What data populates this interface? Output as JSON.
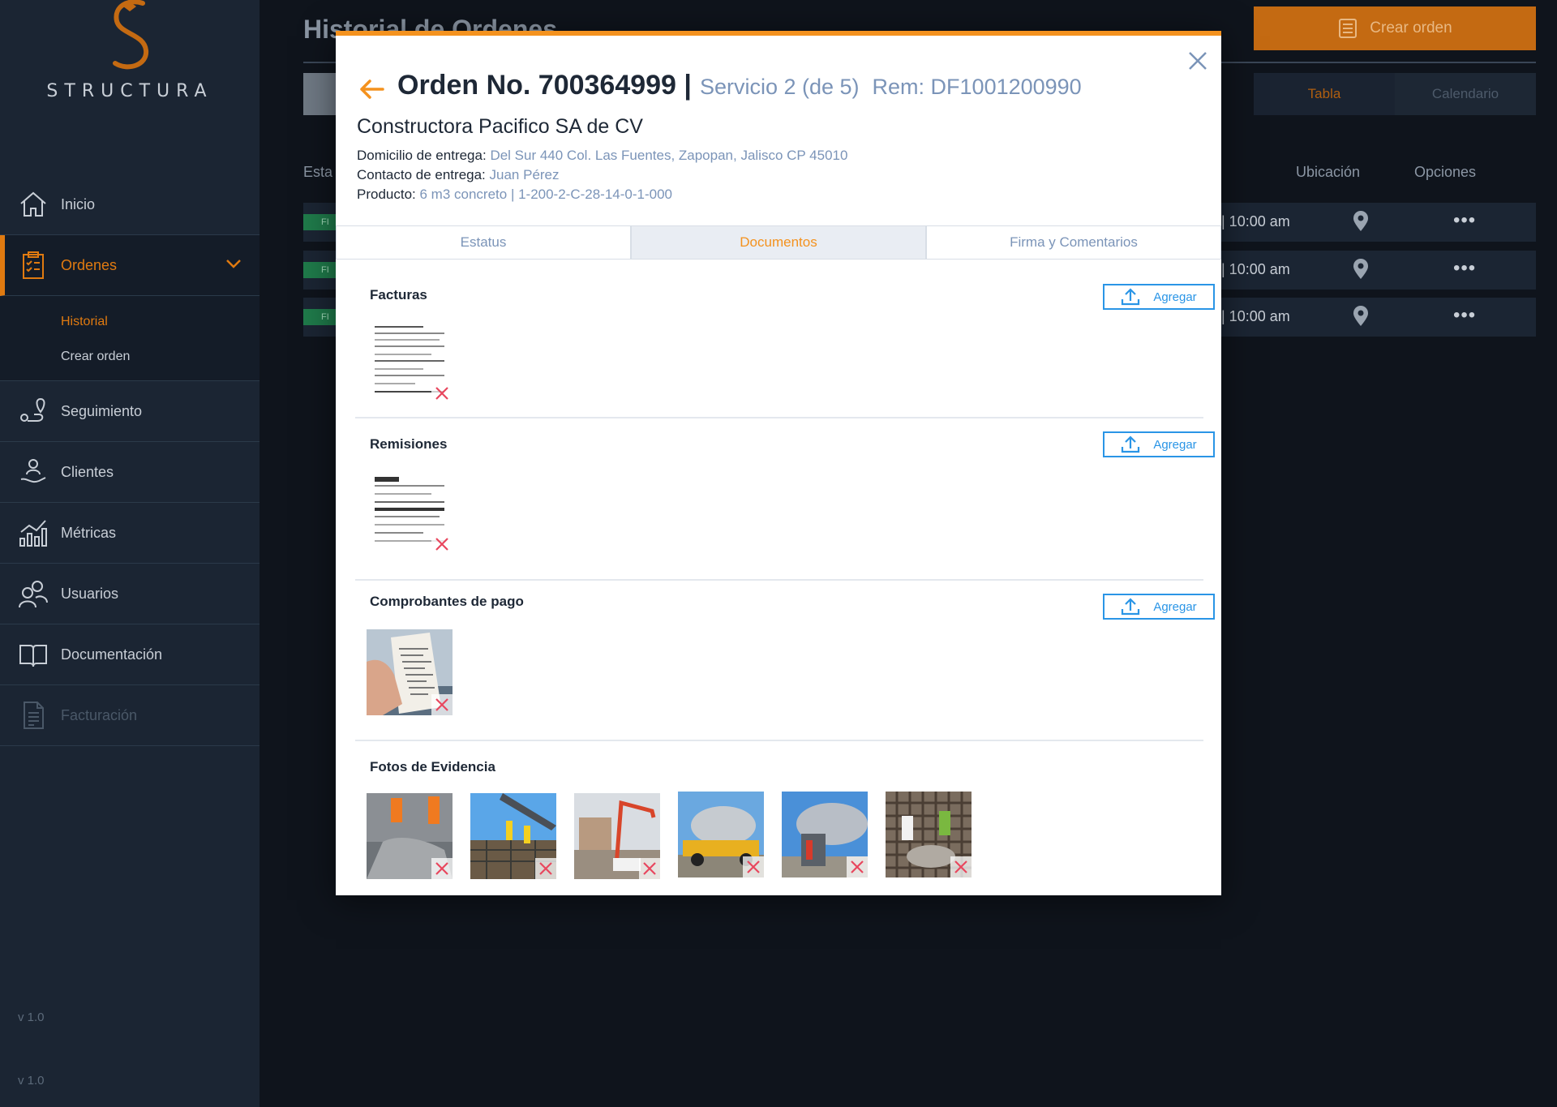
{
  "brand": {
    "name": "STRUCTURA",
    "accent": "#e07a10"
  },
  "sidebar": {
    "items": [
      {
        "label": "Inicio",
        "icon": "home-icon"
      },
      {
        "label": "Ordenes",
        "icon": "clipboard-icon"
      },
      {
        "label": "Seguimiento",
        "icon": "map-route-icon"
      },
      {
        "label": "Clientes",
        "icon": "user-hand-icon"
      },
      {
        "label": "Métricas",
        "icon": "bar-chart-icon"
      },
      {
        "label": "Usuarios",
        "icon": "users-icon"
      },
      {
        "label": "Documentación",
        "icon": "book-icon"
      },
      {
        "label": "Facturación",
        "icon": "invoice-icon"
      }
    ],
    "subitems": [
      {
        "label": "Historial"
      },
      {
        "label": "Crear orden"
      }
    ],
    "version_1": "v 1.0",
    "version_2": "v 1.0"
  },
  "background": {
    "title": "Historial de Ordenes",
    "create_label": "Crear orden",
    "view_table": "Tabla",
    "view_calendar": "Calendario",
    "col_status": "Esta",
    "col_location": "Ubicación",
    "col_options": "Opciones",
    "rows": [
      {
        "status": "FI",
        "time": "| 10:00 am"
      },
      {
        "status": "FI",
        "time": "| 10:00 am"
      },
      {
        "status": "FI",
        "time": "| 10:00 am"
      }
    ]
  },
  "modal": {
    "order_label": "Orden No. 700364999",
    "separator": "|",
    "service": "Servicio 2 (de 5)",
    "rem": "Rem: DF1001200990",
    "company": "Constructora Pacifico SA de CV",
    "address_label": "Domicilio de entrega:",
    "address_value": "Del Sur 440 Col. Las Fuentes, Zapopan, Jalisco CP 45010",
    "contact_label": "Contacto de entrega:",
    "contact_value": "Juan Pérez",
    "product_label": "Producto:",
    "product_value": "6 m3 concreto | 1-200-2-C-28-14-0-1-000",
    "tabs": [
      {
        "label": "Estatus"
      },
      {
        "label": "Documentos"
      },
      {
        "label": "Firma y Comentarios"
      }
    ],
    "add_label": "Agregar",
    "sections": [
      {
        "title": "Facturas"
      },
      {
        "title": "Remisiones"
      },
      {
        "title": "Comprobantes de pago"
      },
      {
        "title": "Fotos de Evidencia"
      }
    ]
  }
}
